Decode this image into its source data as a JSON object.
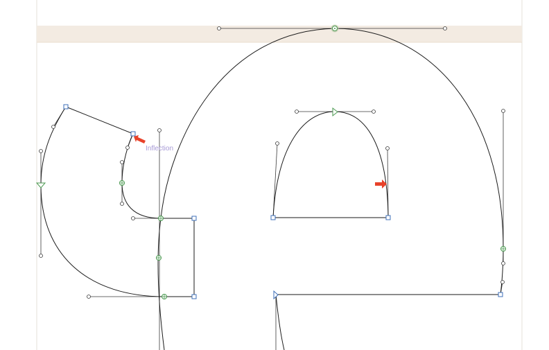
{
  "editor": {
    "inflection_label": "Inflection"
  },
  "colors": {
    "canvas_background": "#ffffff",
    "metric_band": "#f3ebe2",
    "outline": "#1a1a1a",
    "corner_node": "#3e6fb8",
    "smooth_node": "#4c9a52",
    "marker_arrow": "#e8422a",
    "inflection_text": "#a79ad6"
  }
}
